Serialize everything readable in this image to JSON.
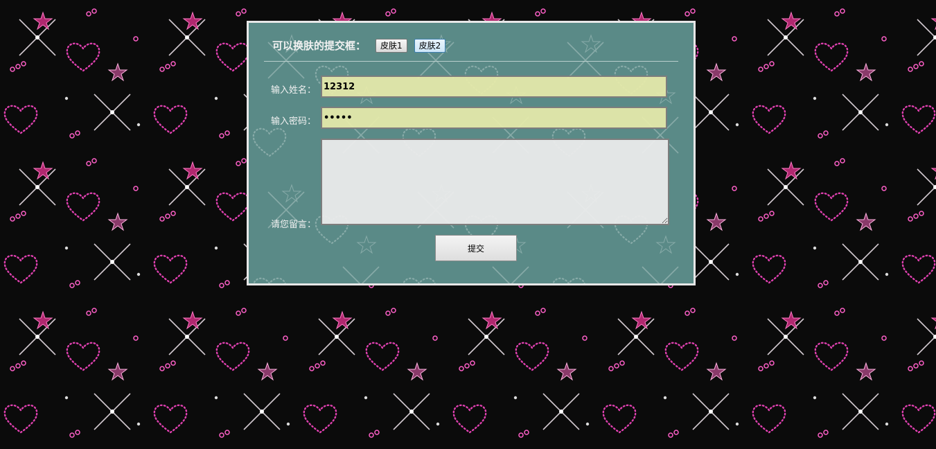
{
  "form": {
    "title": "可以换肤的提交框：",
    "skin_buttons": [
      {
        "label": "皮肤1"
      },
      {
        "label": "皮肤2"
      }
    ],
    "name_label": "输入姓名：",
    "name_value": "12312",
    "password_label": "输入密码：",
    "password_value": "12345",
    "message_label": "请您留言：",
    "message_value": "",
    "submit_label": "提交"
  },
  "colors": {
    "page_background": "#0b0b0b",
    "panel_background": "#5a8a87",
    "panel_border": "#e7e7e7",
    "input_background": "#e7eaaa",
    "textarea_background": "#ececec",
    "decor_pink": "#e040b0",
    "decor_white": "#ffffff"
  },
  "icons": [
    "heart-pattern-icon",
    "star-icon",
    "sparkle-icon"
  ]
}
